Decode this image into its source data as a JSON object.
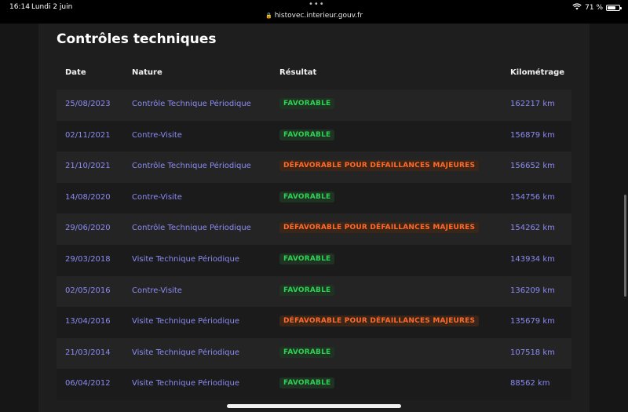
{
  "status_bar": {
    "time": "16:14",
    "date": "Lundi 2 juin",
    "url": "histovec.interieur.gouv.fr",
    "battery": "71 %",
    "battery_level": 0.71
  },
  "section_title": "Contrôles techniques",
  "table": {
    "headers": {
      "date": "Date",
      "nature": "Nature",
      "result": "Résultat",
      "mileage": "Kilométrage"
    },
    "rows": [
      {
        "date": "25/08/2023",
        "nature": "Contrôle Technique Périodique",
        "result": "FAVORABLE",
        "status": "ok",
        "mileage": "162217 km"
      },
      {
        "date": "02/11/2021",
        "nature": "Contre-Visite",
        "result": "FAVORABLE",
        "status": "ok",
        "mileage": "156879 km"
      },
      {
        "date": "21/10/2021",
        "nature": "Contrôle Technique Périodique",
        "result": "DÉFAVORABLE POUR DÉFAILLANCES MAJEURES",
        "status": "bad",
        "mileage": "156652 km"
      },
      {
        "date": "14/08/2020",
        "nature": "Contre-Visite",
        "result": "FAVORABLE",
        "status": "ok",
        "mileage": "154756 km"
      },
      {
        "date": "29/06/2020",
        "nature": "Contrôle Technique Périodique",
        "result": "DÉFAVORABLE POUR DÉFAILLANCES MAJEURES",
        "status": "bad",
        "mileage": "154262 km"
      },
      {
        "date": "29/03/2018",
        "nature": "Visite Technique Périodique",
        "result": "FAVORABLE",
        "status": "ok",
        "mileage": "143934 km"
      },
      {
        "date": "02/05/2016",
        "nature": "Contre-Visite",
        "result": "FAVORABLE",
        "status": "ok",
        "mileage": "136209 km"
      },
      {
        "date": "13/04/2016",
        "nature": "Visite Technique Périodique",
        "result": "DÉFAVORABLE POUR DÉFAILLANCES MAJEURES",
        "status": "bad",
        "mileage": "135679 km"
      },
      {
        "date": "21/03/2014",
        "nature": "Visite Technique Périodique",
        "result": "FAVORABLE",
        "status": "ok",
        "mileage": "107518 km"
      },
      {
        "date": "06/04/2012",
        "nature": "Visite Technique Périodique",
        "result": "FAVORABLE",
        "status": "ok",
        "mileage": "88562 km"
      }
    ]
  },
  "colors": {
    "background": "#161616",
    "panel": "#1e1e1e",
    "link": "#8b8bf5",
    "ok": "#2fd155",
    "bad": "#ff6a2b"
  }
}
